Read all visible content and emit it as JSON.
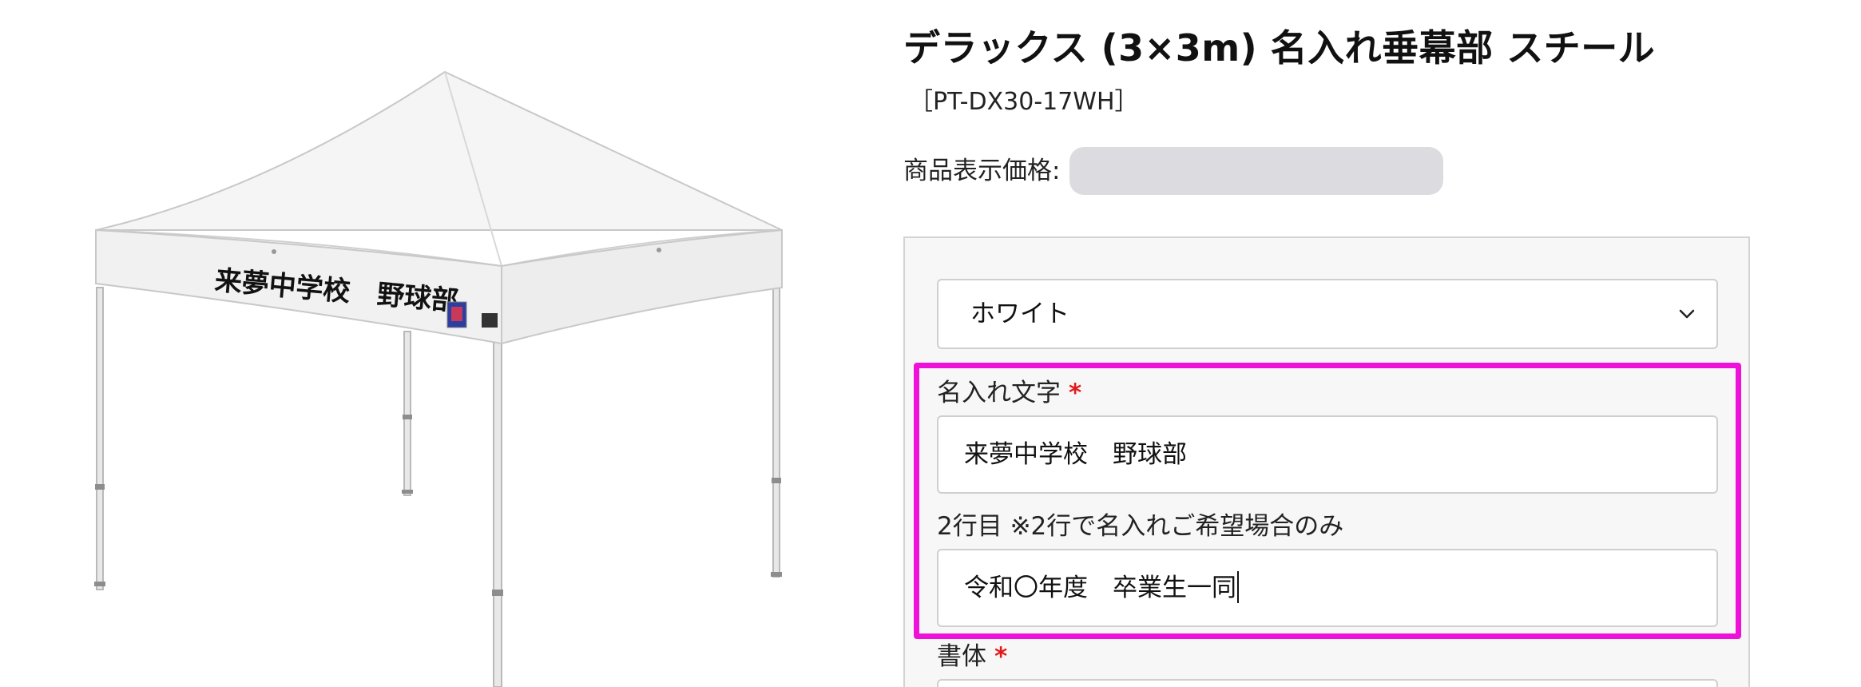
{
  "product": {
    "title": "デラックス (3×3m) 名入れ垂幕部 スチール",
    "sku": "［PT-DX30-17WH］",
    "price_label": "商品表示価格:",
    "image_banner_text": "来夢中学校　野球部"
  },
  "form": {
    "color_select": {
      "value": "ホワイト"
    },
    "name_text": {
      "label": "名入れ文字",
      "required_mark": "*",
      "value": "来夢中学校　野球部"
    },
    "second_line": {
      "label": "2行目 ※2行で名入れご希望場合のみ",
      "value": "令和〇年度　卒業生一同"
    },
    "font_field": {
      "label": "書体",
      "required_mark": "*"
    }
  },
  "colors": {
    "highlight": "#ee11d8",
    "required": "#e21a1a",
    "form_background": "#f7f7f7",
    "price_blur": "#dcdbdf"
  },
  "icons": {
    "select_arrow": "chevron-down-icon"
  }
}
